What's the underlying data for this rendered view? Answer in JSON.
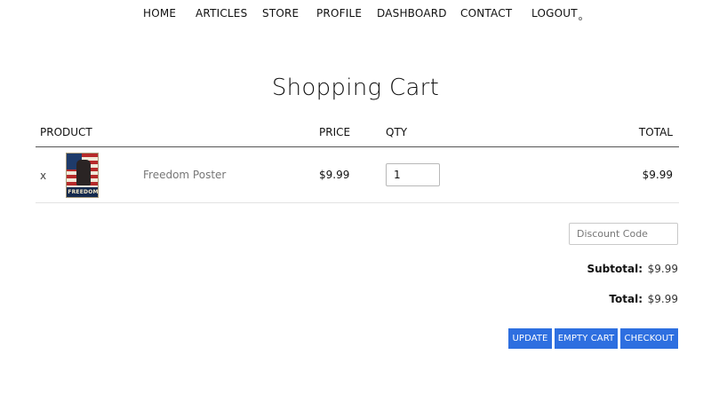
{
  "nav": {
    "items": [
      {
        "label": "HOME"
      },
      {
        "label": "ARTICLES"
      },
      {
        "label": "STORE"
      },
      {
        "label": "PROFILE"
      },
      {
        "label": "DASHBOARD"
      },
      {
        "label": "CONTACT"
      },
      {
        "label": "LOGOUT"
      }
    ]
  },
  "page": {
    "title": "Shopping Cart"
  },
  "cart": {
    "headers": {
      "product": "PRODUCT",
      "price": "PRICE",
      "qty": "QTY",
      "total": "TOTAL"
    },
    "items": [
      {
        "remove_label": "x",
        "image_text": "FREEDOM",
        "name": "Freedom Poster",
        "price": "$9.99",
        "qty": "1",
        "total": "$9.99"
      }
    ]
  },
  "discount": {
    "placeholder": "Discount Code"
  },
  "summary": {
    "subtotal_label": "Subtotal:",
    "subtotal_value": "$9.99",
    "total_label": "Total:",
    "total_value": "$9.99"
  },
  "actions": {
    "update_label": "UPDATE",
    "empty_label": "EMPTY CART",
    "checkout_label": "CHECKOUT"
  },
  "colors": {
    "button": "#2e6fe0",
    "poster_red": "#b62a2a",
    "poster_blue": "#1e3b6b"
  },
  "icons": {
    "logout": "logout-dot-icon",
    "poster": "freedom-poster-thumbnail"
  }
}
